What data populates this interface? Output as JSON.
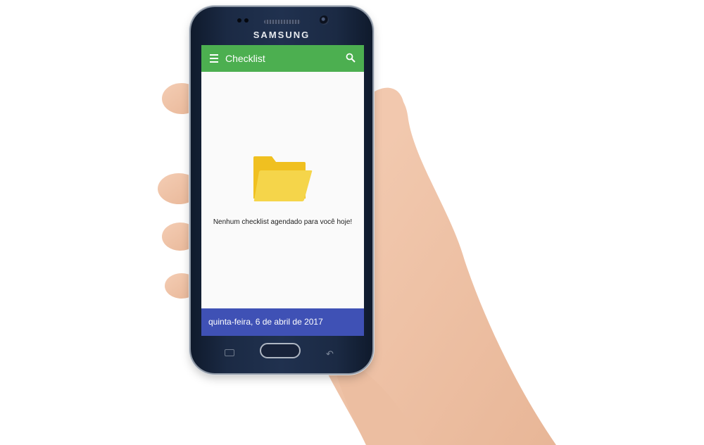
{
  "device": {
    "brand": "SAMSUNG"
  },
  "app": {
    "toolbar": {
      "title": "Checklist",
      "menu_icon": "hamburger-menu-icon",
      "search_icon": "search-icon",
      "color": "#4caf50"
    },
    "empty_state": {
      "icon": "folder-icon",
      "message": "Nenhum checklist agendado para você hoje!"
    },
    "footer": {
      "date": "quinta-feira, 6 de abril de 2017",
      "color": "#3f51b5"
    }
  }
}
